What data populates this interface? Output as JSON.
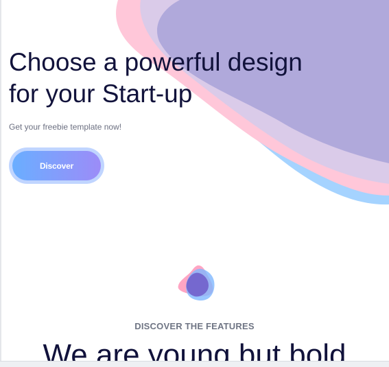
{
  "hero": {
    "title": "Choose a powerful design for your Start-up",
    "subtitle": "Get your freebie template now!",
    "cta_label": "Discover"
  },
  "features": {
    "kicker": "DISCOVER THE FEATURES",
    "heading": "We are young but bold"
  },
  "colors": {
    "title_text": "#11123b",
    "blob_pink": "#ffc7d9",
    "blob_purple": "#b0a9db",
    "blob_blue": "#a5d3ff",
    "button_gradient_start": "#6aaeff",
    "button_gradient_end": "#9c8cf8"
  },
  "icons": {
    "feature_logo": "overlapping-shapes-logo"
  }
}
